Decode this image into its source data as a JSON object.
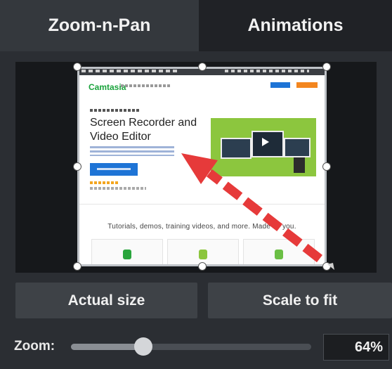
{
  "tabs": [
    {
      "label": "Zoom-n-Pan",
      "active": true
    },
    {
      "label": "Animations",
      "active": false
    }
  ],
  "preview": {
    "site": {
      "logo": "Camtasia",
      "headline": "Screen Recorder and Video Editor",
      "tagline": "Tutorials, demos, training videos, and more. Made by you."
    },
    "annotation": {
      "type": "arrow",
      "color": "#e63a3a",
      "style": "dashed"
    }
  },
  "buttons": {
    "actual_size": "Actual size",
    "scale_to_fit": "Scale to fit"
  },
  "zoom": {
    "label": "Zoom:",
    "value": "64%",
    "slider_fraction": 0.3
  },
  "colors": {
    "panel": "#2b2e33",
    "tab_active": "#34383d",
    "tab_inactive": "#202226",
    "button": "#3e4247",
    "arrow": "#e63a3a"
  }
}
